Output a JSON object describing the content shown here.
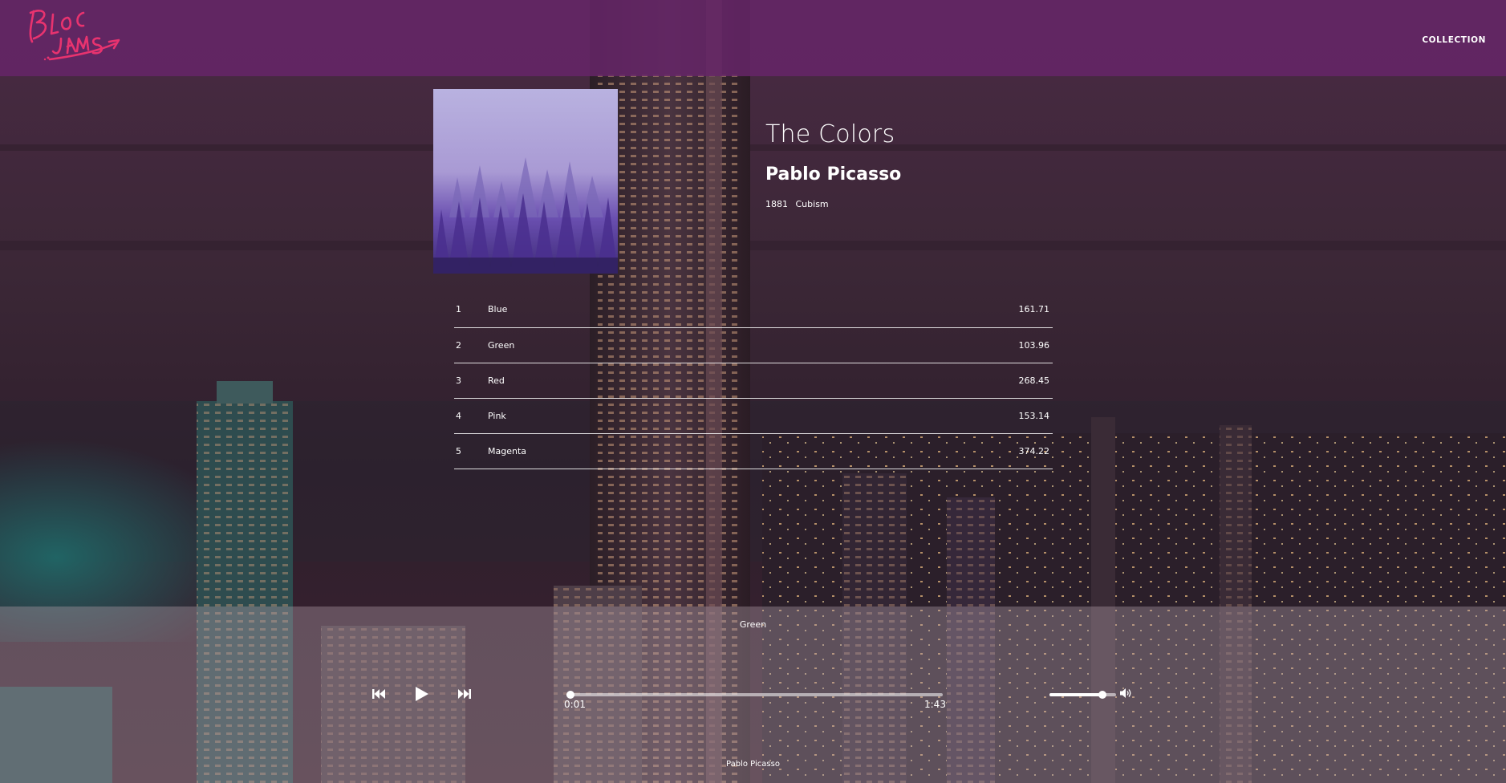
{
  "navbar": {
    "logo_text": "Bloc Jams",
    "collection_link": "COLLECTION"
  },
  "album": {
    "title": "The Colors",
    "artist": "Pablo Picasso",
    "year": "1881",
    "label": "Cubism"
  },
  "songs": [
    {
      "number": "1",
      "title": "Blue",
      "duration": "161.71"
    },
    {
      "number": "2",
      "title": "Green",
      "duration": "103.96"
    },
    {
      "number": "3",
      "title": "Red",
      "duration": "268.45"
    },
    {
      "number": "4",
      "title": "Pink",
      "duration": "153.14"
    },
    {
      "number": "5",
      "title": "Magenta",
      "duration": "374.22"
    }
  ],
  "player": {
    "current_song": "Green",
    "current_artist": "Pablo Picasso",
    "current_time": "0:01",
    "total_time": "1:43",
    "progress_fraction": 0.01,
    "volume_fraction": 0.8,
    "icons": {
      "previous": "previous-track-icon",
      "play": "play-icon",
      "next": "next-track-icon",
      "volume": "volume-icon"
    }
  },
  "colors": {
    "navbar": "#652568",
    "logo": "#e8336f"
  }
}
